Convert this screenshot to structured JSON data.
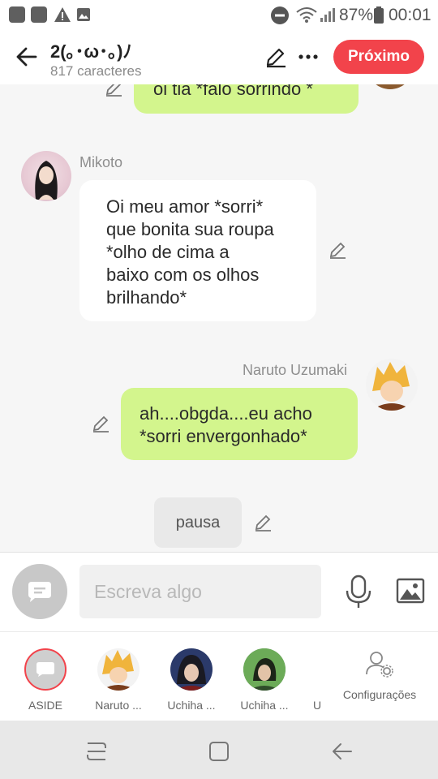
{
  "status_bar": {
    "battery": "87%",
    "time": "00:01"
  },
  "header": {
    "title": "2(｡･ω･｡)ﾉ",
    "subtitle": "817 caracteres",
    "next_label": "Próximo"
  },
  "messages": [
    {
      "sender": "",
      "side": "right",
      "text": "oi tia *falo sorrindo *"
    },
    {
      "sender": "Mikoto",
      "side": "left",
      "lines": [
        "Oi meu amor *sorri*",
        "que bonita sua roupa",
        "*olho de cima a",
        "baixo com os olhos",
        "brilhando*"
      ]
    },
    {
      "sender": "Naruto Uzumaki",
      "side": "right",
      "lines": [
        "ah....obgda....eu acho",
        "*sorri envergonhado*"
      ]
    },
    {
      "sender": "",
      "side": "center",
      "text": "pausa"
    }
  ],
  "input": {
    "placeholder": "Escreva algo"
  },
  "characters": [
    {
      "label": "ASIDE"
    },
    {
      "label": "Naruto ..."
    },
    {
      "label": "Uchiha ..."
    },
    {
      "label": "Uchiha ..."
    },
    {
      "label": "U"
    },
    {
      "label": "Configurações"
    }
  ],
  "colors": {
    "accent": "#f2434b",
    "green_bubble": "#d3f58d",
    "white_bubble": "#ffffff",
    "chat_background": "#f6f6f6"
  }
}
